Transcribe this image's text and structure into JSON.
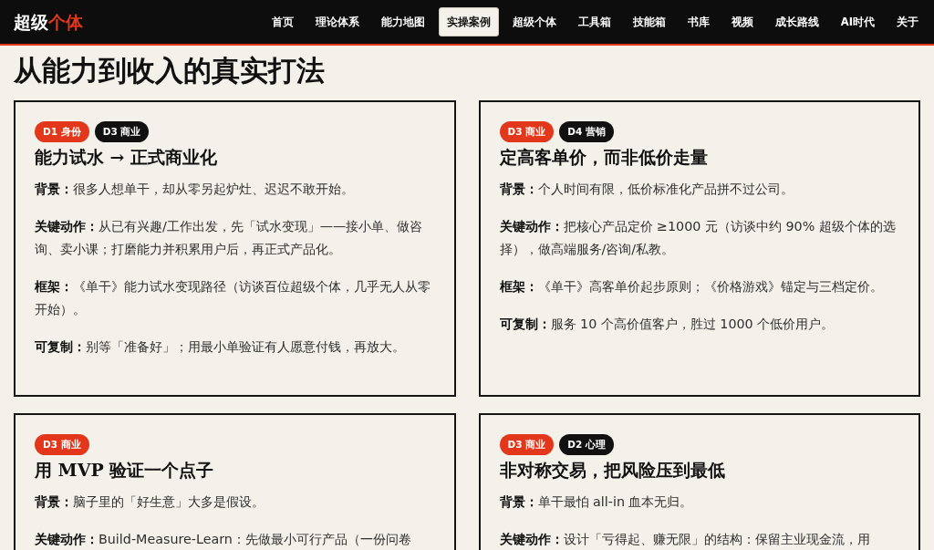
{
  "header": {
    "logo": {
      "text": "超级",
      "highlight": "个体"
    },
    "nav": [
      {
        "label": "首页",
        "selected": false
      },
      {
        "label": "理论体系",
        "selected": false
      },
      {
        "label": "能力地图",
        "selected": false
      },
      {
        "label": "实操案例",
        "selected": true
      },
      {
        "label": "超级个体",
        "selected": false
      },
      {
        "label": "工具箱",
        "selected": false
      },
      {
        "label": "技能箱",
        "selected": false
      },
      {
        "label": "书库",
        "selected": false
      },
      {
        "label": "视频",
        "selected": false
      },
      {
        "label": "成长路线",
        "selected": false
      },
      {
        "label": "AI时代",
        "selected": false
      },
      {
        "label": "关于",
        "selected": false
      }
    ]
  },
  "page": {
    "title": "从能力到收入的真实打法"
  },
  "cards": [
    {
      "tags": [
        {
          "label": "D1 身份",
          "color": "#e2371b"
        },
        {
          "label": "D3 商业",
          "color": "#111111"
        }
      ],
      "title": "能力试水 → 正式商业化",
      "sections": [
        {
          "label": "背景：",
          "text": "很多人想单干，却从零另起炉灶、迟迟不敢开始。"
        },
        {
          "label": "关键动作：",
          "text": "从已有兴趣/工作出发，先「试水变现」——接小单、做咨询、卖小课；打磨能力并积累用户后，再正式产品化。"
        },
        {
          "label": "框架：",
          "text": "《单干》能力试水变现路径（访谈百位超级个体，几乎无人从零开始）。"
        },
        {
          "label": "可复制：",
          "text": "别等「准备好」；用最小单验证有人愿意付钱，再放大。"
        }
      ]
    },
    {
      "tags": [
        {
          "label": "D3 商业",
          "color": "#e2371b"
        },
        {
          "label": "D4 营销",
          "color": "#111111"
        }
      ],
      "title": "定高客单价，而非低价走量",
      "sections": [
        {
          "label": "背景：",
          "text": "个人时间有限，低价标准化产品拼不过公司。"
        },
        {
          "label": "关键动作：",
          "text": "把核心产品定价 ≥1000 元（访谈中约 90% 超级个体的选择），做高端服务/咨询/私教。"
        },
        {
          "label": "框架：",
          "text": "《单干》高客单价起步原则；《价格游戏》锚定与三档定价。"
        },
        {
          "label": "可复制：",
          "text": "服务 10 个高价值客户，胜过 1000 个低价用户。"
        }
      ]
    },
    {
      "tags": [
        {
          "label": "D3 商业",
          "color": "#e2371b"
        }
      ],
      "title": "用 MVP 验证一个点子",
      "sections": [
        {
          "label": "背景：",
          "text": "脑子里的「好生意」大多是假设。"
        },
        {
          "label": "关键动作：",
          "text": "Build-Measure-Learn：先做最小可行产品（一份问卷"
        }
      ]
    },
    {
      "tags": [
        {
          "label": "D3 商业",
          "color": "#e2371b"
        },
        {
          "label": "D2 心理",
          "color": "#111111"
        }
      ],
      "title": "非对称交易，把风险压到最低",
      "sections": [
        {
          "label": "背景：",
          "text": "单干最怕 all-in 血本无归。"
        },
        {
          "label": "关键动作：",
          "text": "设计「亏得起、赚无限」的结构：保留主业现金流，用"
        }
      ]
    }
  ]
}
